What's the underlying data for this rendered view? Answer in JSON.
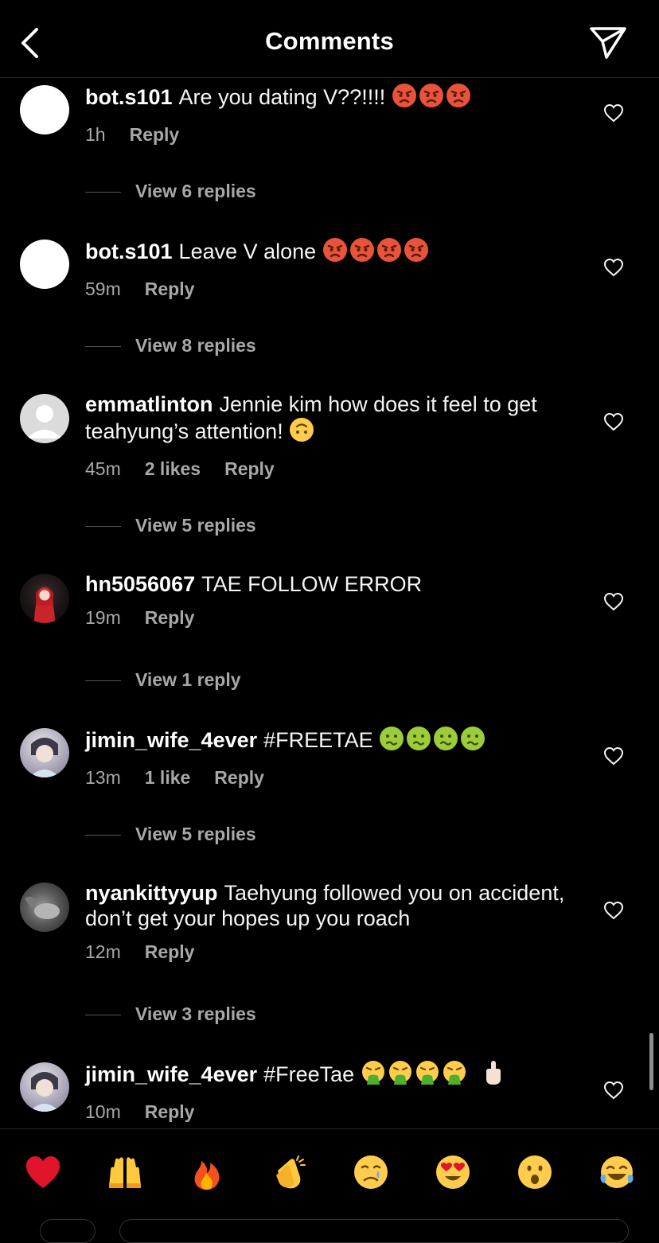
{
  "header": {
    "title": "Comments"
  },
  "comments": [
    {
      "username": "bot.s101",
      "text": "Are you dating V??!!!!",
      "emoji": "angry",
      "emoji_count": 3,
      "time": "1h",
      "likes": "",
      "reply": "Reply",
      "view_replies": "View 6 replies"
    },
    {
      "username": "bot.s101",
      "text": "Leave V alone",
      "emoji": "angry",
      "emoji_count": 4,
      "time": "59m",
      "likes": "",
      "reply": "Reply",
      "view_replies": "View 8 replies"
    },
    {
      "username": "emmatlinton",
      "text": "Jennie kim how does it feel to get teahyung’s attention!",
      "emoji": "upside-down-face",
      "emoji_count": 1,
      "time": "45m",
      "likes": "2 likes",
      "reply": "Reply",
      "view_replies": "View 5 replies"
    },
    {
      "username": "hn5056067",
      "text": "TAE FOLLOW ERROR",
      "emoji": "",
      "emoji_count": 0,
      "time": "19m",
      "likes": "",
      "reply": "Reply",
      "view_replies": "View 1 reply"
    },
    {
      "username": "jimin_wife_4ever",
      "text": "#FREETAE",
      "emoji": "nauseated-face",
      "emoji_count": 4,
      "time": "13m",
      "likes": "1 like",
      "reply": "Reply",
      "view_replies": "View 5 replies"
    },
    {
      "username": "nyankittyyup",
      "text": "Taehyung followed you on accident, don’t get your hopes up you roach",
      "emoji": "",
      "emoji_count": 0,
      "time": "12m",
      "likes": "",
      "reply": "Reply",
      "view_replies": "View 3 replies"
    },
    {
      "username": "jimin_wife_4ever",
      "text": "#FreeTae",
      "emoji": "vomiting-face",
      "emoji_count": 4,
      "extra_emoji": "middle-finger",
      "time": "10m",
      "likes": "",
      "reply": "Reply",
      "view_replies": ""
    }
  ],
  "reactions": [
    "red-heart",
    "raising-hands",
    "fire",
    "clapping-hands",
    "crying-face",
    "heart-eyes",
    "astonished-face",
    "tears-of-joy"
  ],
  "icons": {
    "back": "chevron-left-icon",
    "send": "paper-plane-icon",
    "like": "heart-outline-icon"
  },
  "colors": {
    "background": "#000000",
    "text": "#f5f5f5",
    "muted": "#a8a8a8",
    "divider": "#262626"
  }
}
